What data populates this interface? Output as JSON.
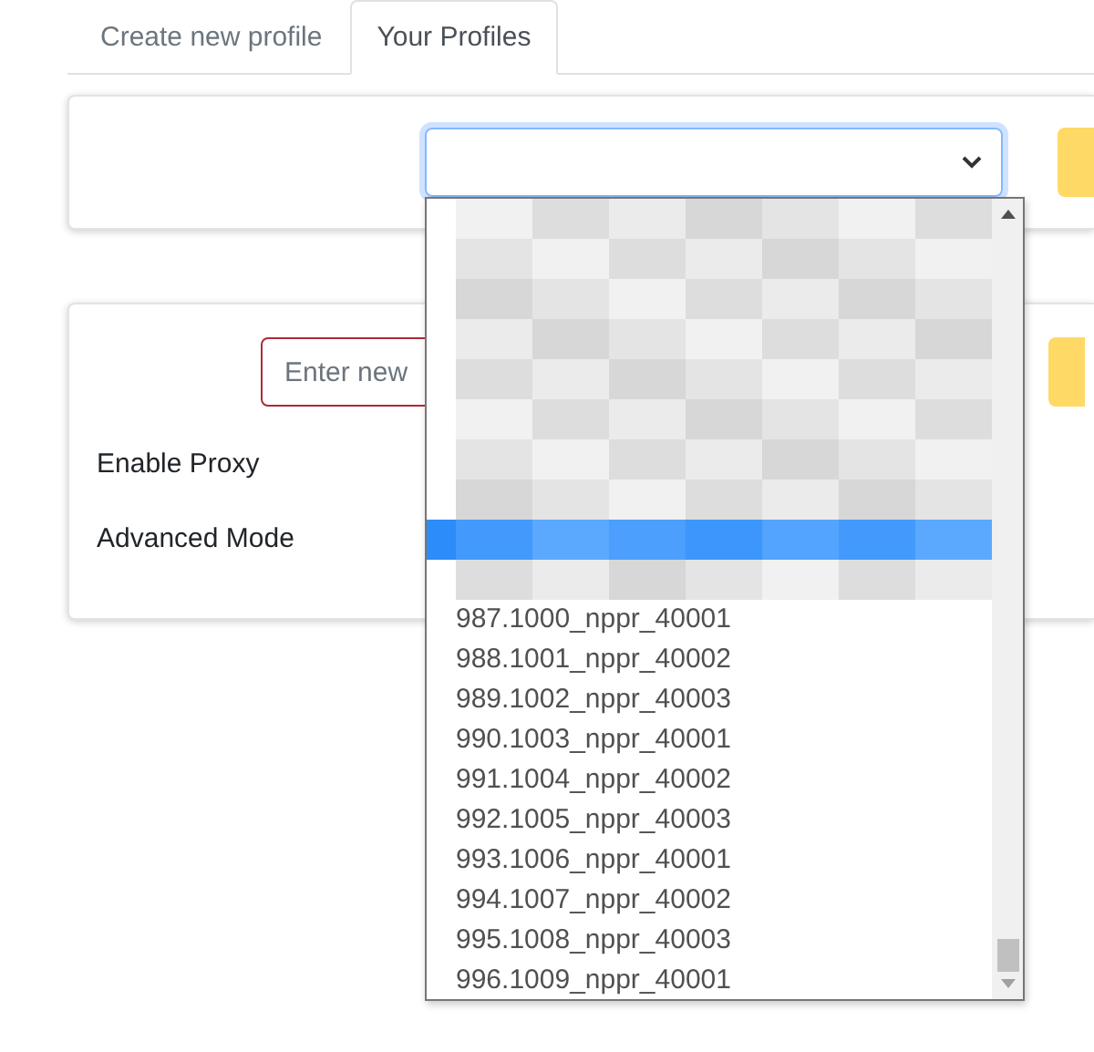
{
  "tabs": [
    {
      "label": "Create new profile",
      "selected": false
    },
    {
      "label": "Your Profiles",
      "selected": true
    }
  ],
  "new_profile_card": {
    "name_field": {
      "placeholder": "Enter new"
    },
    "labels": [
      "Enable Proxy",
      "Advanced Mode"
    ]
  },
  "dropdown": {
    "options": [
      {
        "kind": "redacted",
        "selected": false
      },
      {
        "kind": "redacted",
        "selected": false
      },
      {
        "kind": "redacted",
        "selected": false
      },
      {
        "kind": "redacted",
        "selected": false
      },
      {
        "kind": "redacted",
        "selected": false
      },
      {
        "kind": "redacted",
        "selected": false
      },
      {
        "kind": "redacted",
        "selected": false
      },
      {
        "kind": "redacted",
        "selected": false
      },
      {
        "kind": "redacted",
        "selected": true
      },
      {
        "kind": "redacted",
        "selected": false
      },
      {
        "kind": "text",
        "label": "987.1000_nppr_40001",
        "selected": false
      },
      {
        "kind": "text",
        "label": "988.1001_nppr_40002",
        "selected": false
      },
      {
        "kind": "text",
        "label": "989.1002_nppr_40003",
        "selected": false
      },
      {
        "kind": "text",
        "label": "990.1003_nppr_40001",
        "selected": false
      },
      {
        "kind": "text",
        "label": "991.1004_nppr_40002",
        "selected": false
      },
      {
        "kind": "text",
        "label": "992.1005_nppr_40003",
        "selected": false
      },
      {
        "kind": "text",
        "label": "993.1006_nppr_40001",
        "selected": false
      },
      {
        "kind": "text",
        "label": "994.1007_nppr_40002",
        "selected": false
      },
      {
        "kind": "text",
        "label": "995.1008_nppr_40003",
        "selected": false
      },
      {
        "kind": "text",
        "label": "996.1009_nppr_40001",
        "selected": false
      }
    ]
  }
}
